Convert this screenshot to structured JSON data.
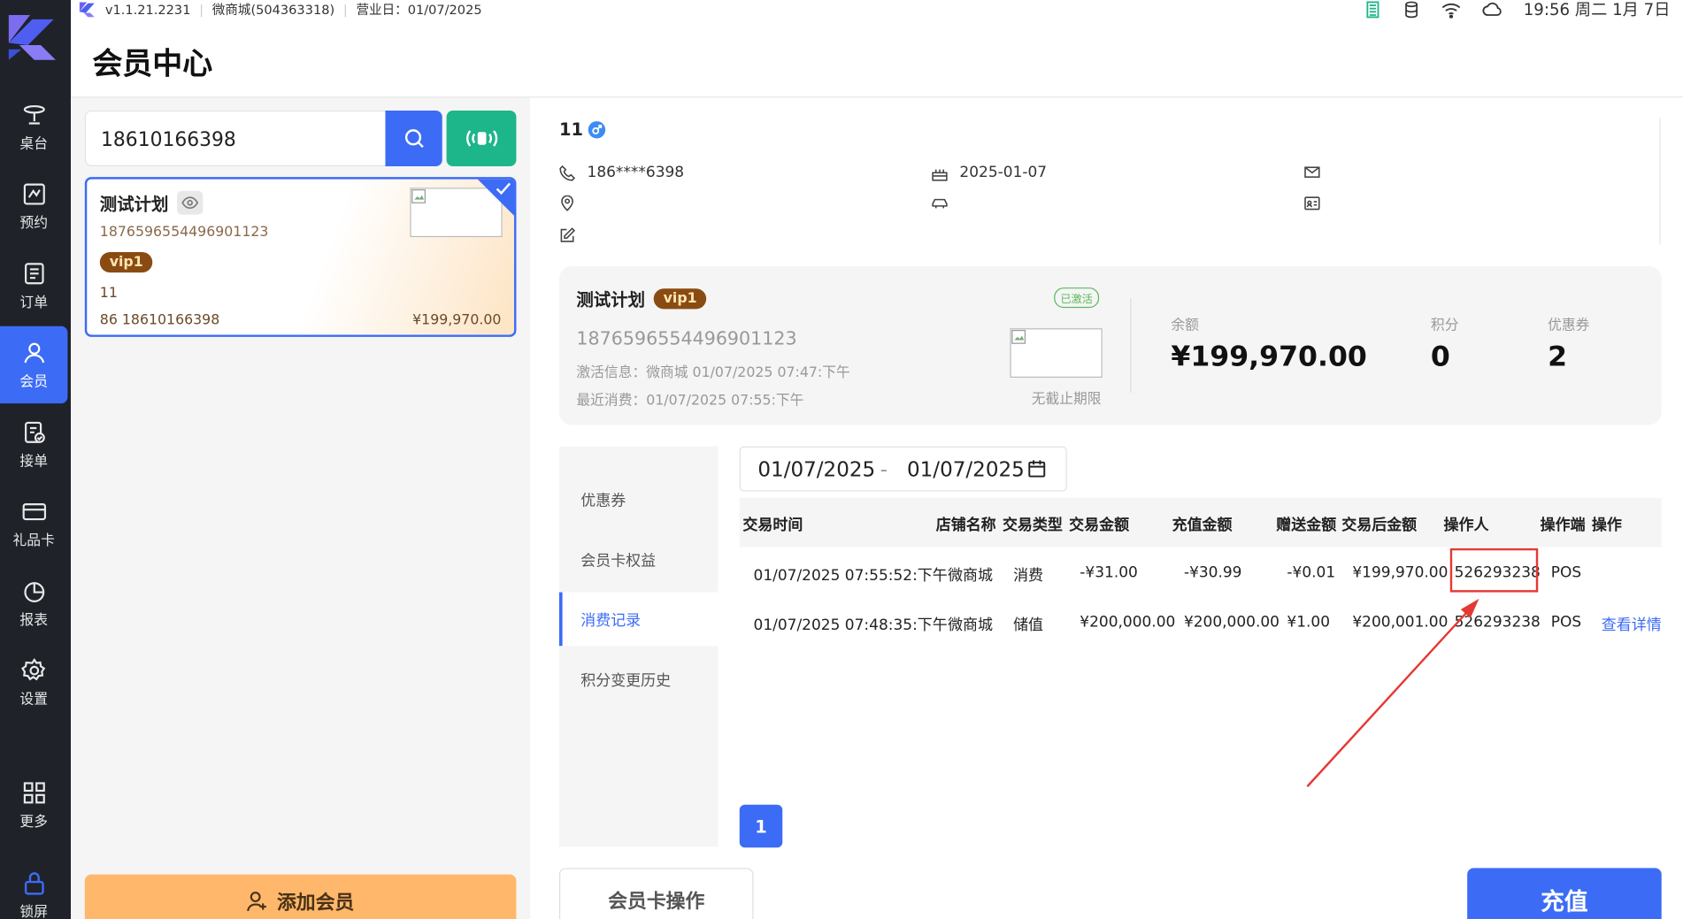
{
  "status_bar": {
    "version": "v1.1.21.2231",
    "store": "微商城(504363318)",
    "business_day": "营业日：01/07/2025",
    "clock": "19:56 周二 1月 7日"
  },
  "page": {
    "title": "会员中心"
  },
  "nav": {
    "items": [
      {
        "label": "桌台",
        "icon": "dish-icon"
      },
      {
        "label": "预约",
        "icon": "reservation-icon"
      },
      {
        "label": "订单",
        "icon": "order-icon"
      },
      {
        "label": "会员",
        "icon": "member-icon"
      },
      {
        "label": "接单",
        "icon": "accept-order-icon"
      },
      {
        "label": "礼品卡",
        "icon": "gift-card-icon"
      },
      {
        "label": "报表",
        "icon": "report-icon"
      },
      {
        "label": "设置",
        "icon": "settings-icon"
      },
      {
        "label": "更多",
        "icon": "more-icon"
      },
      {
        "label": "锁屏",
        "icon": "lock-icon"
      }
    ],
    "active": "会员"
  },
  "search": {
    "value": "18610166398"
  },
  "member_card_item": {
    "name": "测试计划",
    "card_no": "1876596554496901123",
    "level": "vip1",
    "member_name": "11",
    "phone": "86 18610166398",
    "balance": "¥199,970.00"
  },
  "add_member": {
    "label": "添加会员"
  },
  "member": {
    "name": "11",
    "phone": "186****6398",
    "birthday": "2025-01-07"
  },
  "summary": {
    "card_name": "测试计划",
    "level": "vip1",
    "status": "已激活",
    "card_no": "1876596554496901123",
    "activation": "激活信息：微商城  01/07/2025 07:47:下午",
    "last_consume": "最近消费：01/07/2025 07:55:下午",
    "expiry": "无截止期限",
    "balance_label": "余额",
    "balance": "¥199,970.00",
    "points_label": "积分",
    "points": "0",
    "coupons_label": "优惠券",
    "coupons": "2"
  },
  "tabs": [
    {
      "label": "优惠券"
    },
    {
      "label": "会员卡权益"
    },
    {
      "label": "消费记录"
    },
    {
      "label": "积分变更历史"
    }
  ],
  "active_tab": "消费记录",
  "date_range": {
    "start": "01/07/2025",
    "sep": "-",
    "end": "01/07/2025"
  },
  "table": {
    "headers": [
      "交易时间",
      "店铺名称",
      "交易类型",
      "交易金额",
      "充值金额",
      "赠送金额",
      "交易后金额",
      "操作人",
      "操作端",
      "操作"
    ],
    "rows": [
      [
        "01/07/2025 07:55:52:下午",
        "微商城",
        "消费",
        "-¥31.00",
        "-¥30.99",
        "-¥0.01",
        "¥199,970.00",
        "526293238",
        "POS",
        ""
      ],
      [
        "01/07/2025 07:48:35:下午",
        "微商城",
        "储值",
        "¥200,000.00",
        "¥200,000.00",
        "¥1.00",
        "¥200,001.00",
        "526293238",
        "POS",
        "查看详情"
      ]
    ]
  },
  "pagination": {
    "current": "1"
  },
  "footer": {
    "card_ops": "会员卡操作",
    "recharge": "充值"
  },
  "colors": {
    "primary": "#3c6cf5",
    "nfc": "#1db58a",
    "add": "#ffb86b",
    "vip": "#8a4b12",
    "highlight": "#e53935"
  }
}
